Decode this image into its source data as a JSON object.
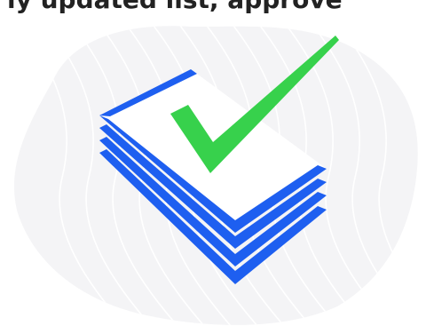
{
  "heading": {
    "text": "ly updated list, approve"
  },
  "illustration": {
    "blob_color": "#f4f4f6",
    "wave_line_color": "#ffffff",
    "paper_fill_color": "#ffffff",
    "paper_stroke_color": "#1e5ff0",
    "check_color": "#37d14c",
    "icons": [
      "document-stack-icon",
      "checkmark-icon"
    ]
  }
}
